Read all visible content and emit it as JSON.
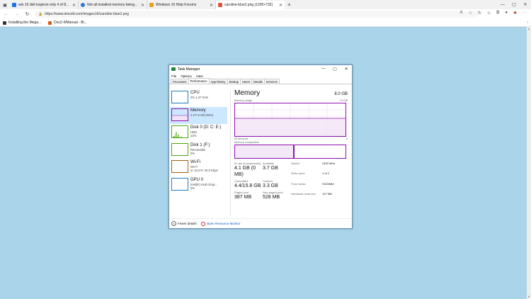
{
  "browser": {
    "tabs": [
      {
        "title": "win 10 dell inspiron only 4 of 8...",
        "color": "#1a73e8",
        "active": false
      },
      {
        "title": "Not all installed memory being...",
        "color": "#2e7cd6",
        "active": false
      },
      {
        "title": "Windows 10 Help Forums",
        "color": "#e6a11e",
        "active": false
      },
      {
        "title": "caroline-blue2.png (1200×732)",
        "color": "#e0563a",
        "active": true
      }
    ],
    "url": "https://www.drocdd.com/images16/caroline-blue2.png",
    "bookmarks": [
      {
        "label": "Installing the Mega...",
        "color": "#333333"
      },
      {
        "label": "Doc2.4/Manual - Bi...",
        "color": "#d85a1a"
      }
    ]
  },
  "taskmanager": {
    "title": "Task Manager",
    "menu": [
      "File",
      "Options",
      "View"
    ],
    "tabs": [
      "Processes",
      "Performance",
      "App history",
      "Startup",
      "Users",
      "Details",
      "Services"
    ],
    "active_tab": "Performance",
    "sidebar": [
      {
        "name": "CPU",
        "sub1": "2%  1.47 GHz",
        "sub2": "",
        "color": "#1f7bbf"
      },
      {
        "name": "Memory",
        "sub1": "4.2/7.9 GB (53%)",
        "sub2": "",
        "color": "#8b12ae"
      },
      {
        "name": "Disk 0 (D: C: E:)",
        "sub1": "HDD",
        "sub2": "12%",
        "color": "#4da60c"
      },
      {
        "name": "Disk 1 (F:)",
        "sub1": "Removable",
        "sub2": "0%",
        "color": "#4da60c"
      },
      {
        "name": "Wi-Fi",
        "sub1": "Wi-Fi",
        "sub2": "S: 16.0  R: 32.0 Kbps",
        "color": "#a75e0e"
      },
      {
        "name": "GPU 0",
        "sub1": "Intel(R) UHD Grap...",
        "sub2": "0%",
        "color": "#1f7bbf"
      }
    ],
    "memory": {
      "title": "Memory",
      "total": "8.0 GB",
      "usage_label": "Memory usage",
      "usage_max": "7.8 GB",
      "secs_label": "60 seconds",
      "secs_zero": "0",
      "composition_label": "Memory composition",
      "inuse_label": "In use (Compressed)",
      "inuse_value": "4.1 GB (0 MB)",
      "available_label": "Available",
      "available_value": "3.7 GB",
      "committed_label": "Committed",
      "committed_value": "4.4/15.8 GB",
      "cached_label": "Cached",
      "cached_value": "3.3 GB",
      "paged_label": "Paged pool",
      "paged_value": "387 MB",
      "nonpaged_label": "Non-paged pool",
      "nonpaged_value": "528 MB",
      "right": [
        {
          "k": "Speed:",
          "v": "2400 MHz"
        },
        {
          "k": "Slots used:",
          "v": "1 of 2"
        },
        {
          "k": "Form factor:",
          "v": "SODIMM"
        },
        {
          "k": "Hardware reserved:",
          "v": "127 MB"
        }
      ]
    },
    "footer": {
      "fewer": "Fewer details",
      "monitor": "Open Resource Monitor"
    }
  }
}
